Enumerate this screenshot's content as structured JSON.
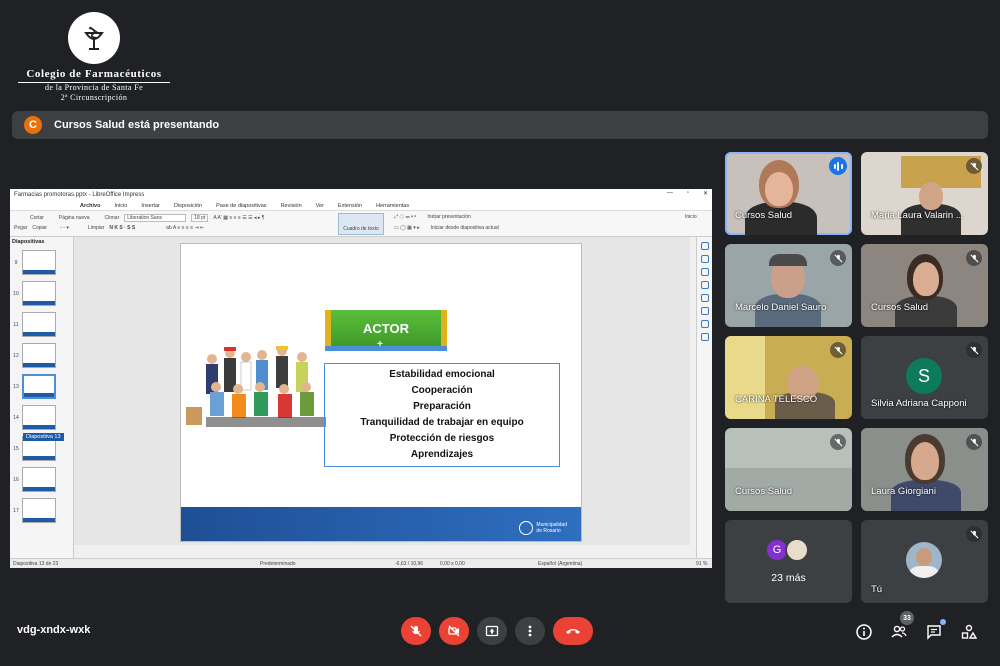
{
  "logo": {
    "title": "Colegio de Farmacéuticos",
    "line2": "de la Provincia de Santa Fe",
    "line3": "2ª Circunscripción"
  },
  "presenting": {
    "avatar_letter": "C",
    "text": "Cursos Salud está presentando"
  },
  "impress": {
    "window_title": "Farmacias promotoras.pptx - LibreOffice Impress",
    "menu": [
      "Archivo",
      "Inicio",
      "Insertar",
      "Disposición",
      "Pase de diapositivas",
      "Revisión",
      "Ver",
      "Extensión",
      "Herramientas"
    ],
    "toolbar": {
      "cut": "Cortar",
      "new_page": "Página nueva",
      "clone": "Clonar",
      "font": "Liberation Sans",
      "size": "18 pt",
      "paste": "Pegar",
      "copy": "Copiar",
      "clear": "Limpiar",
      "text_box": "Cuadro de texto",
      "start_show": "Iniciar presentación",
      "start_current": "Iniciar desde diapositiva actual",
      "home": "Inicio"
    },
    "slides_panel_title": "Diapositivas",
    "thumb_numbers": [
      "9",
      "10",
      "11",
      "12",
      "13",
      "14",
      "15",
      "16",
      "17"
    ],
    "tooltip": "Diapositiva 13",
    "status": {
      "slide": "Diapositiva 13 de 23",
      "layout": "Predeterminado",
      "coords": "-6,63 / 10,96",
      "size": "0,00 x 0,00",
      "lang": "Español (Argentina)",
      "zoom": "91 %"
    }
  },
  "slide": {
    "actor_label": "ACTOR",
    "plus": "+",
    "items": [
      "Estabilidad emocional",
      "Cooperación",
      "Preparación",
      "Tranquilidad de trabajar en equipo",
      "Protección de riesgos",
      "Aprendizajes"
    ],
    "footer_brand": [
      "Municipalidad",
      "de Rosario"
    ]
  },
  "participants": [
    {
      "name": "Cursos Salud",
      "state": "speaking"
    },
    {
      "name": "Maria Laura Valarin ...",
      "state": "muted"
    },
    {
      "name": "Marcelo Daniel Sauro",
      "state": "muted"
    },
    {
      "name": "Cursos Salud",
      "state": "muted"
    },
    {
      "name": "CARINA TELESCO",
      "state": "muted"
    },
    {
      "name": "Silvia Adriana Capponi",
      "state": "muted",
      "avatar": "S"
    },
    {
      "name": "Cursos Salud",
      "state": "muted"
    },
    {
      "name": "Laura Giorgiani",
      "state": "muted"
    }
  ],
  "more": {
    "avatar_letter": "G",
    "text": "23 más"
  },
  "self": {
    "name": "Tú"
  },
  "meeting_code": "vdg-xndx-wxk",
  "people_count": "33",
  "colors": {
    "accent": "#8ab4f8",
    "danger": "#ea4335",
    "tile": "#3c4043",
    "bg": "#202124"
  }
}
